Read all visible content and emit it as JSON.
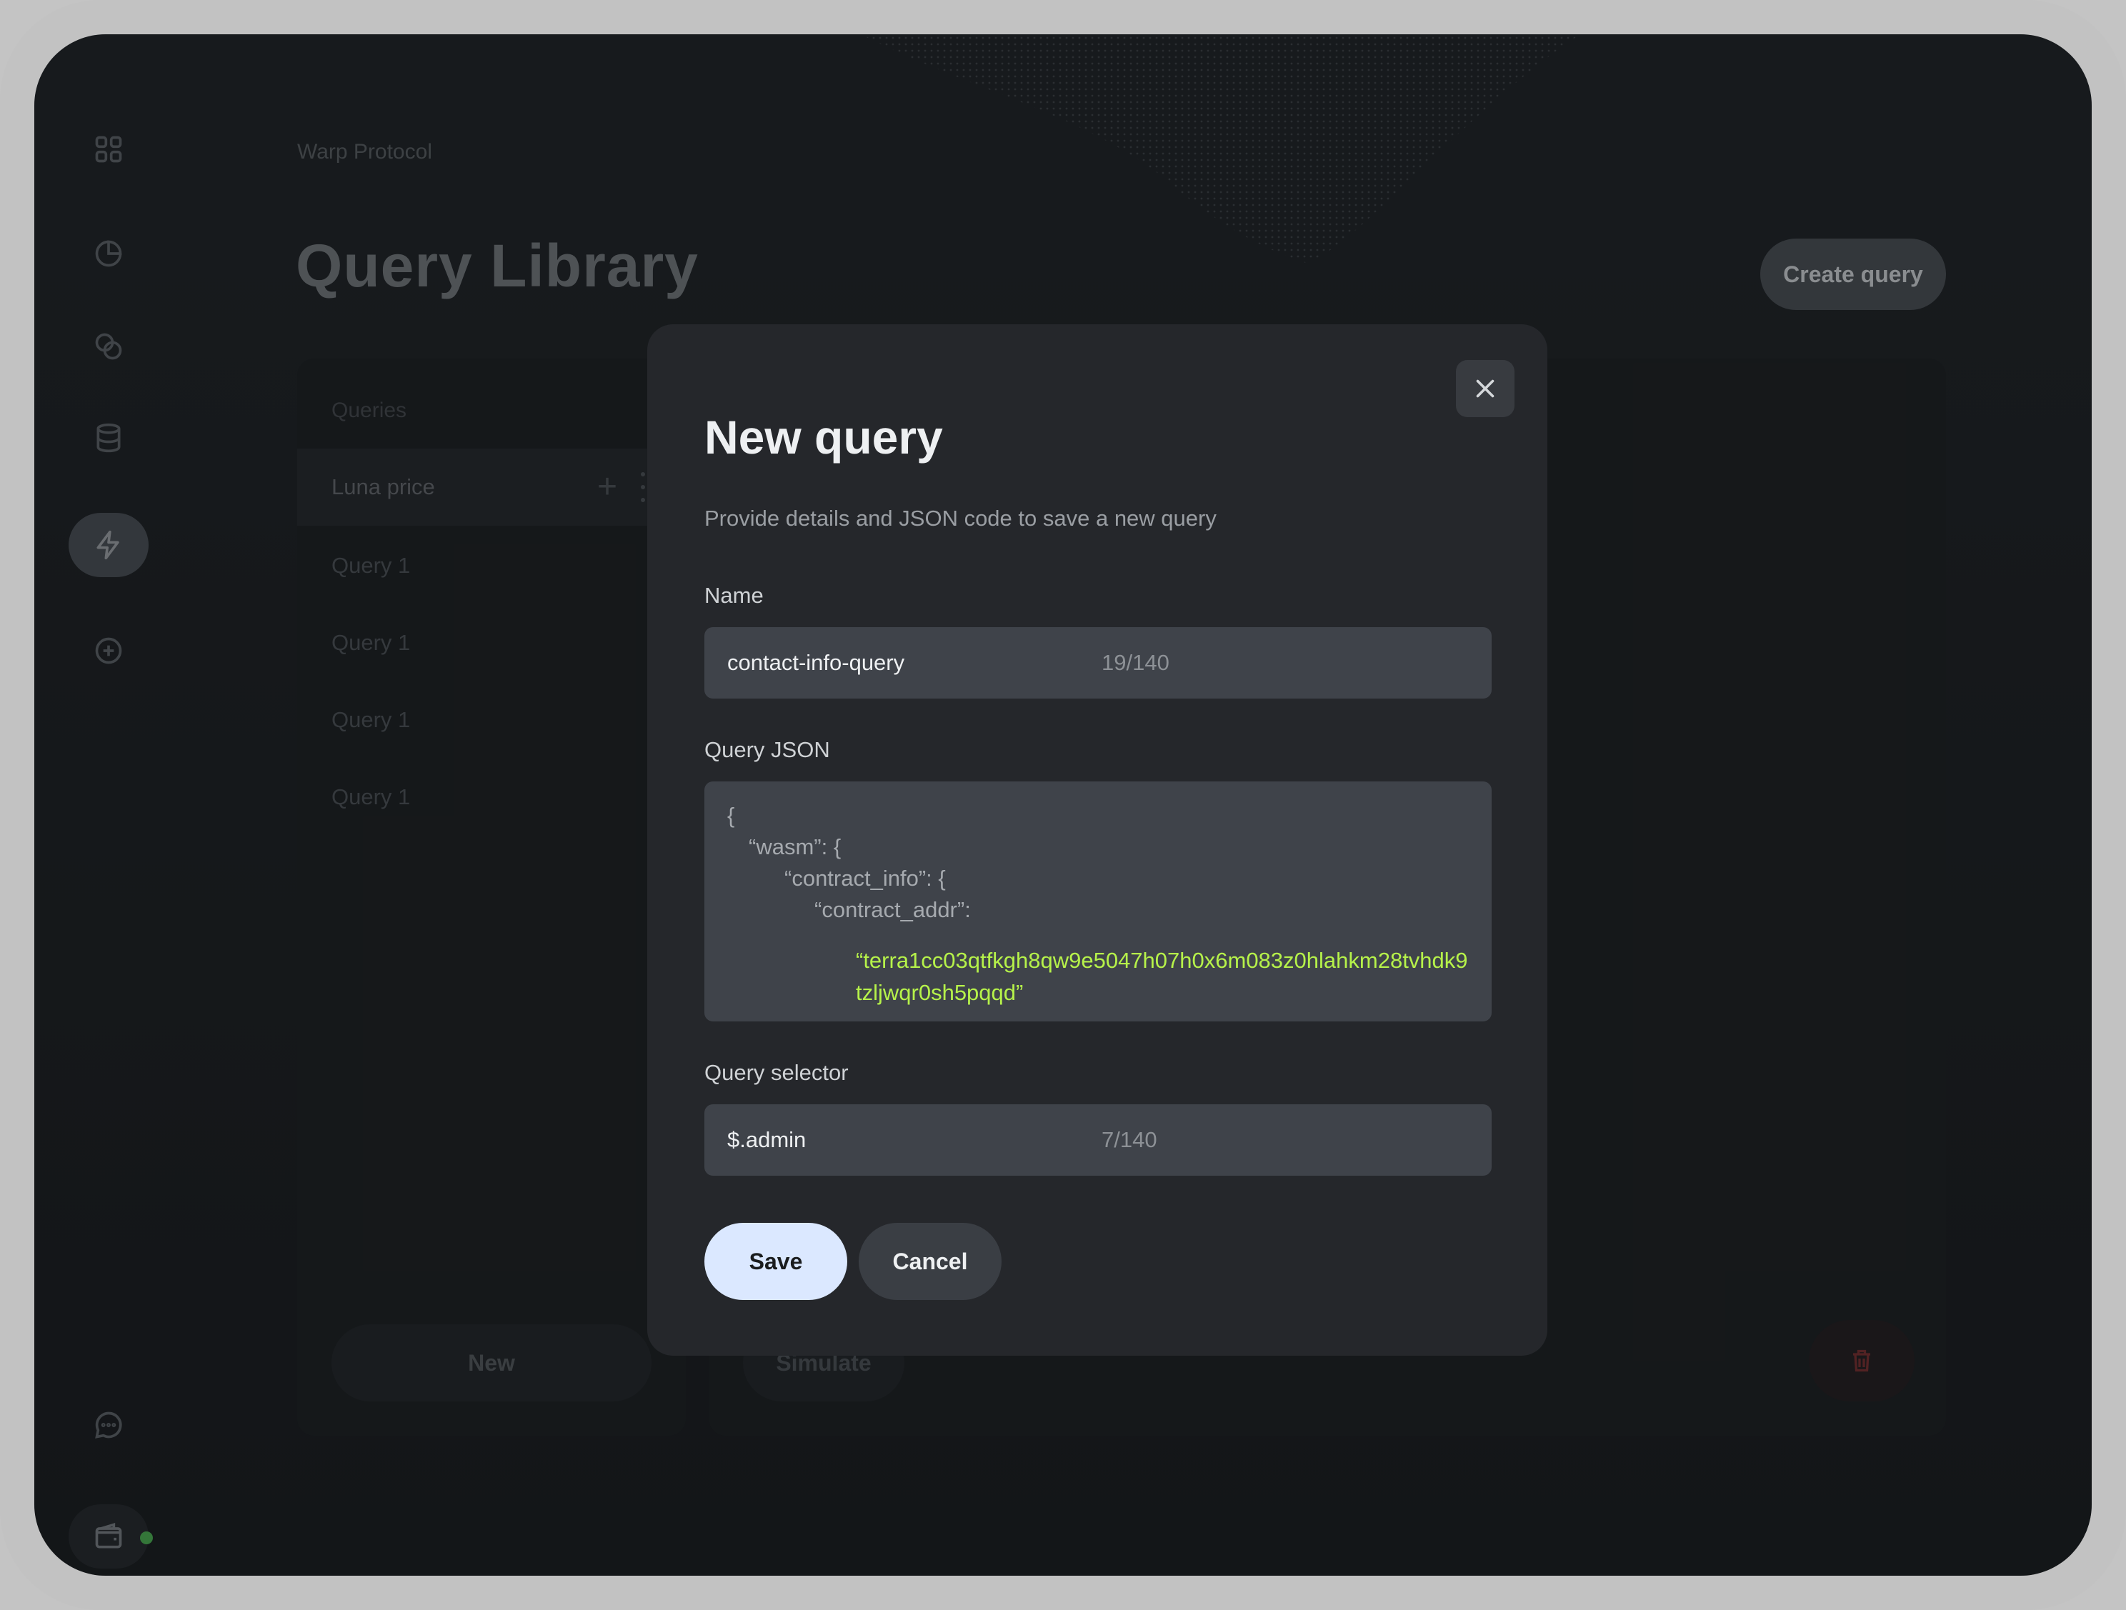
{
  "app": {
    "breadcrumb": "Warp Protocol",
    "page_title": "Query Library",
    "create_query_label": "Create query"
  },
  "sidebar": {
    "items": [
      {
        "icon": "grid-icon"
      },
      {
        "icon": "pie-chart-icon"
      },
      {
        "icon": "link-icon"
      },
      {
        "icon": "database-icon"
      },
      {
        "icon": "lightning-icon",
        "active": true
      },
      {
        "icon": "plus-circle-icon"
      },
      {
        "icon": "chat-icon"
      },
      {
        "icon": "wallet-icon"
      }
    ],
    "status_color": "#4caf50"
  },
  "queries_panel": {
    "label": "Queries",
    "items": [
      {
        "label": "Luna price",
        "selected": true
      },
      {
        "label": "Query 1"
      },
      {
        "label": "Query 1"
      },
      {
        "label": "Query 1"
      },
      {
        "label": "Query 1"
      }
    ],
    "new_label": "New"
  },
  "editor_panel": {
    "simulate_label": "Simulate"
  },
  "modal": {
    "title": "New query",
    "subtitle": "Provide details and JSON code to save a new query",
    "name": {
      "label": "Name",
      "value": "contact-info-query",
      "count": "19/140"
    },
    "json": {
      "label": "Query JSON",
      "lines": [
        "{",
        "“wasm”: {",
        "“contract_info”: {",
        "“contract_addr”:"
      ],
      "address": "“terra1cc03qtfkgh8qw9e5047h07h0x6m083z0hlahkm28tvhdk9tzljwqr0sh5pqqd”"
    },
    "selector": {
      "label": "Query selector",
      "value": "$.admin",
      "count": "7/140"
    },
    "save_label": "Save",
    "cancel_label": "Cancel"
  },
  "colors": {
    "accent_button": "#dbe8ff",
    "json_string": "#b6f24a"
  }
}
